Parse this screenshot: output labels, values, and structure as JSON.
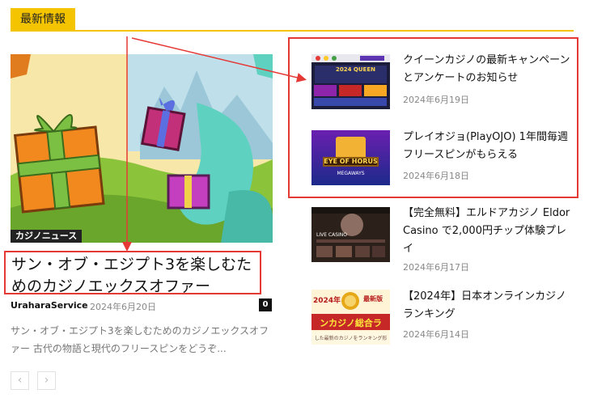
{
  "header": {
    "section_title": "最新情報"
  },
  "featured": {
    "category": "カジノニュース",
    "title": "サン・オブ・エジプト3を楽しむためのカジノエックスオファー",
    "author": "UraharaService",
    "separator": "-",
    "date": "2024年6月20日",
    "comments": "0",
    "excerpt": "サン・オブ・エジプト3を楽しむためのカジノエックスオファー 古代の物語と現代のフリースピンをどうぞ..."
  },
  "items": [
    {
      "title": "クイーンカジノの最新キャンペーンとアンケートのお知らせ",
      "date": "2024年6月19日"
    },
    {
      "title": "プレイオジョ(PlayOJO) 1年間毎週フリースピンがもらえる",
      "date": "2024年6月18日"
    },
    {
      "title": "【完全無料】エルドアカジノ Eldor Casino で2,000円チップ体験プレイ",
      "date": "2024年6月17日"
    },
    {
      "title": "【2024年】日本オンラインカジノランキング",
      "date": "2024年6月14日"
    }
  ],
  "thumbs": {
    "item1_tag": "2024 QUEEN",
    "item2_label": "EYE OF HORUS",
    "item2_sub": "MEGAWAYS",
    "item3_label": "LIVE CASINO",
    "item4_year": "2024年",
    "item4_corner": "最新版",
    "item4_main": "ンカジノ総合ラ",
    "item4_sub": "した最新のカジノをランキング形"
  },
  "pager": {
    "prev": "‹",
    "next": "›"
  },
  "colors": {
    "accent": "#f5c400",
    "annotation": "#e53935"
  }
}
